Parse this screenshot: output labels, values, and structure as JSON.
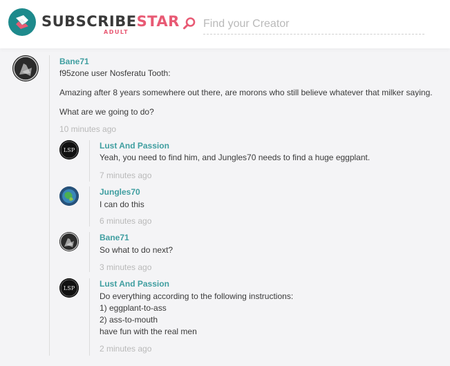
{
  "header": {
    "brand_main": "SUBSCRIBE",
    "brand_star": "STAR",
    "brand_sub": "ADULT",
    "search_placeholder": "Find your Creator",
    "accent_color": "#e85a74",
    "logo_color": "#1e8a8c"
  },
  "comments": [
    {
      "author": "Bane71",
      "lines": [
        "f95zone user Nosferatu Tooth:",
        "Amazing after 8 years somewhere out there, are morons who still believe whatever that milker saying.",
        "What are we going to do?"
      ],
      "time": "10 minutes ago"
    }
  ],
  "replies": [
    {
      "author": "Lust And Passion",
      "lines": [
        "Yeah, you need to find him, and Jungles70 needs to find a huge eggplant."
      ],
      "time": "7 minutes ago"
    },
    {
      "author": "Jungles70",
      "lines": [
        "I can do this"
      ],
      "time": "6 minutes ago"
    },
    {
      "author": "Bane71",
      "lines": [
        "So what to do next?"
      ],
      "time": "3 minutes ago"
    },
    {
      "author": "Lust And Passion",
      "lines": [
        "Do everything according to the following instructions:",
        "1) eggplant-to-ass",
        "2) ass-to-mouth",
        "have fun with the real men"
      ],
      "time": "2 minutes ago"
    }
  ],
  "avatar_labels": {
    "lsp": "LSP"
  }
}
